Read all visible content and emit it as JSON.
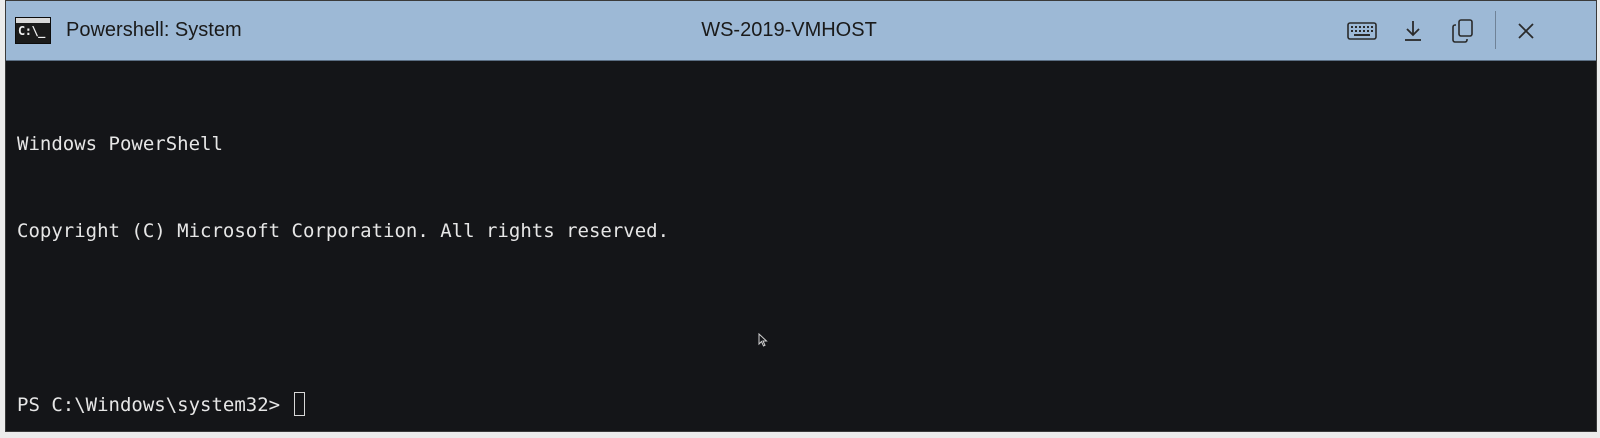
{
  "titlebar": {
    "window_title": "Powershell: System",
    "host_name": "WS-2019-VMHOST",
    "app_icon_text": "C:\\_",
    "background_color": "#9db9d6",
    "buttons": {
      "keyboard_icon": "keyboard-icon",
      "download_icon": "download-icon",
      "copy_icon": "copy-icon",
      "close_icon": "close-icon"
    }
  },
  "terminal": {
    "background_color": "#141518",
    "text_color": "#e6e6e6",
    "lines": [
      "Windows PowerShell",
      "Copyright (C) Microsoft Corporation. All rights reserved.",
      "",
      "PS C:\\Windows\\system32> "
    ]
  }
}
